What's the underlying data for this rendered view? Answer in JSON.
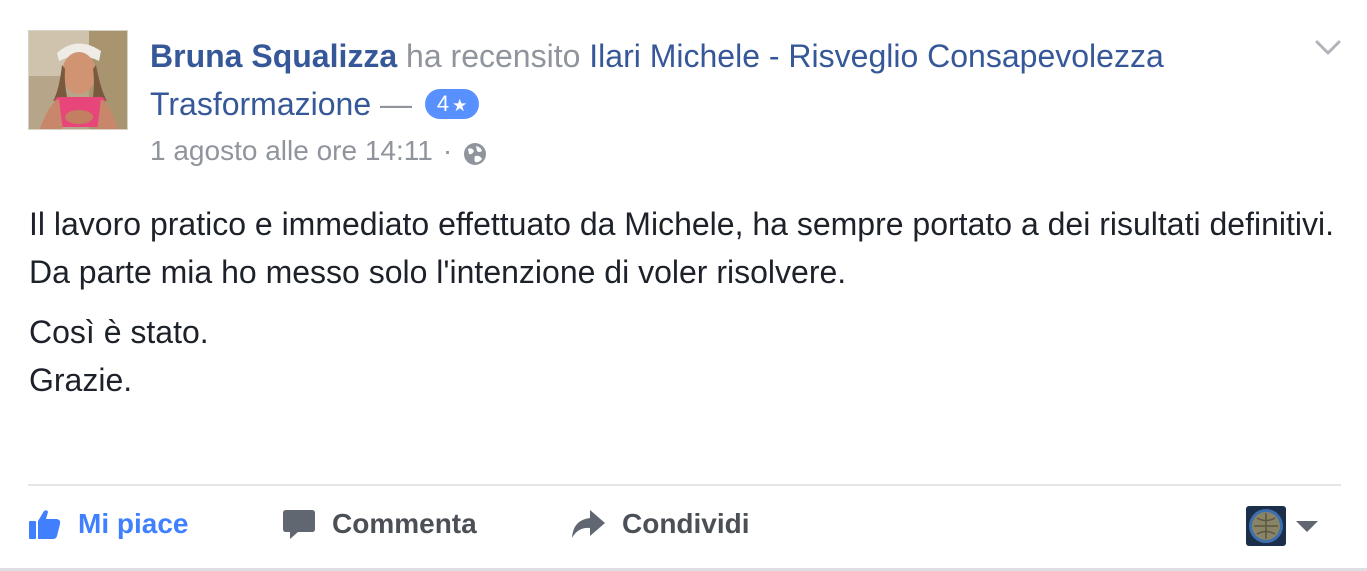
{
  "post": {
    "author": "Bruna Squalizza",
    "verb": "ha recensito",
    "page_name": "Ilari Michele - Risveglio Consapevolezza Trasformazione",
    "dash": "—",
    "rating": "4",
    "timestamp": "1 agosto alle ore 14:11",
    "separator": "·",
    "privacy_icon": "globe-icon",
    "menu_icon": "chevron-down-icon",
    "body": {
      "line1": "Il lavoro pratico e immediato effettuato da Michele, ha sempre portato a dei risultati definitivi.",
      "line2": "Da parte mia ho messo solo l'intenzione di voler risolvere.",
      "line3": "Così è stato.",
      "line4": "Grazie."
    }
  },
  "actions": {
    "like_label": "Mi piace",
    "comment_label": "Commenta",
    "share_label": "Condividi"
  },
  "colors": {
    "link": "#365899",
    "secondary": "#90949c",
    "like_active": "#4080ff",
    "badge": "#5890ff",
    "action_text": "#4b4f56"
  }
}
